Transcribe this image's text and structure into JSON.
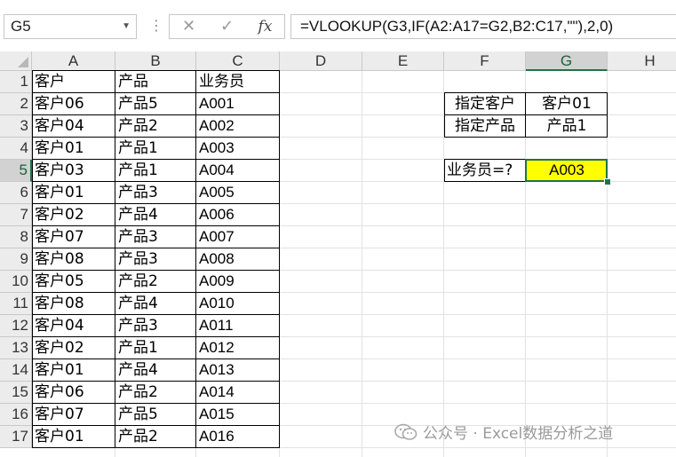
{
  "name_box": {
    "value": "G5"
  },
  "formula_bar": {
    "cancel_glyph": "✕",
    "enter_glyph": "✓",
    "fx_glyph": "fx",
    "formula": "=VLOOKUP(G3,IF(A2:A17=G2,B2:C17,\"\"),2,0)"
  },
  "columns": [
    "A",
    "B",
    "C",
    "D",
    "E",
    "F",
    "G",
    "H"
  ],
  "active_column": "G",
  "rows": [
    "1",
    "2",
    "3",
    "4",
    "5",
    "6",
    "7",
    "8",
    "9",
    "10",
    "11",
    "12",
    "13",
    "14",
    "15",
    "16",
    "17"
  ],
  "active_row": "5",
  "table": {
    "headers": [
      "客户",
      "产品",
      "业务员"
    ],
    "rows": [
      [
        "客户06",
        "产品5",
        "A001"
      ],
      [
        "客户04",
        "产品2",
        "A002"
      ],
      [
        "客户01",
        "产品1",
        "A003"
      ],
      [
        "客户03",
        "产品1",
        "A004"
      ],
      [
        "客户01",
        "产品3",
        "A005"
      ],
      [
        "客户02",
        "产品4",
        "A006"
      ],
      [
        "客户07",
        "产品3",
        "A007"
      ],
      [
        "客户08",
        "产品3",
        "A008"
      ],
      [
        "客户05",
        "产品2",
        "A009"
      ],
      [
        "客户08",
        "产品4",
        "A010"
      ],
      [
        "客户04",
        "产品3",
        "A011"
      ],
      [
        "客户02",
        "产品1",
        "A012"
      ],
      [
        "客户01",
        "产品4",
        "A013"
      ],
      [
        "客户06",
        "产品2",
        "A014"
      ],
      [
        "客户07",
        "产品5",
        "A015"
      ],
      [
        "客户01",
        "产品2",
        "A016"
      ]
    ]
  },
  "lookup": {
    "customer_label": "指定客户",
    "customer_value": "客户01",
    "product_label": "指定产品",
    "product_value": "产品1",
    "result_label": "业务员=?",
    "result_value": "A003"
  },
  "colors": {
    "highlight": "#ffff00",
    "selection": "#217346"
  },
  "watermark": {
    "text": "公众号 · Excel数据分析之道",
    "icon": "wechat-icon"
  }
}
